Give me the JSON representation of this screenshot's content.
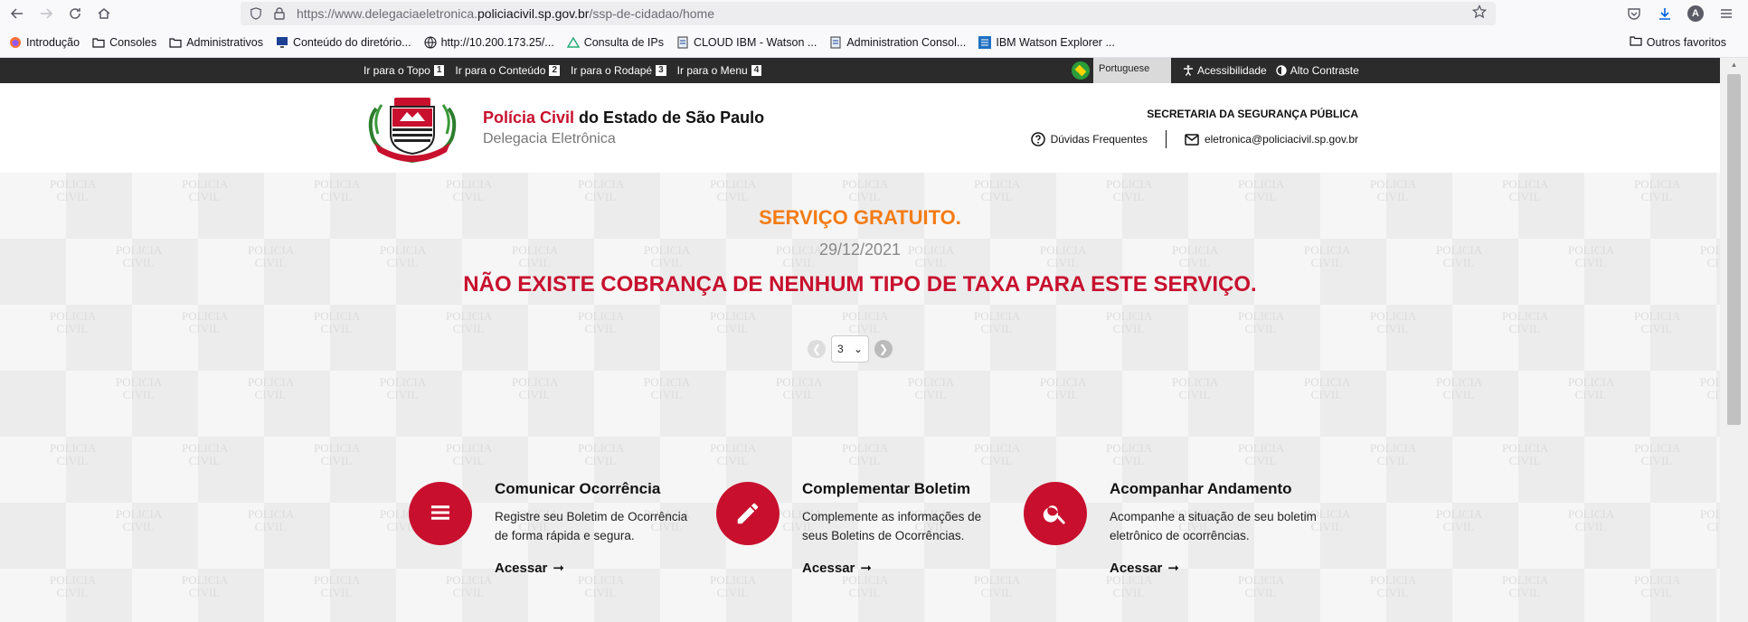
{
  "browser": {
    "url_prefix": "https://www.delegaciaeletronica.",
    "url_domain": "policiacivil.sp.gov.br",
    "url_path": "/ssp-de-cidadao/home",
    "avatar_letter": "A"
  },
  "bookmarks": {
    "items": [
      {
        "label": "Introdução",
        "icon": "firefox-icon"
      },
      {
        "label": "Consoles",
        "icon": "folder-icon"
      },
      {
        "label": "Administrativos",
        "icon": "folder-icon"
      },
      {
        "label": "Conteúdo do diretório...",
        "icon": "monitor-icon"
      },
      {
        "label": "http://10.200.173.25/...",
        "icon": "globe-icon"
      },
      {
        "label": "Consulta de IPs",
        "icon": "triangle-icon"
      },
      {
        "label": "CLOUD IBM - Watson ...",
        "icon": "page-icon"
      },
      {
        "label": "Administration Consol...",
        "icon": "page-icon"
      },
      {
        "label": "IBM Watson Explorer ...",
        "icon": "ibm-icon"
      }
    ],
    "others": "Outros favoritos"
  },
  "accbar": {
    "links": [
      {
        "label": "Ir para o Topo",
        "key": "1"
      },
      {
        "label": "Ir para o Conteúdo",
        "key": "2"
      },
      {
        "label": "Ir para o Rodapé",
        "key": "3"
      },
      {
        "label": "Ir para o Menu",
        "key": "4"
      }
    ],
    "language": "Portuguese",
    "accessibility": "Acessibilidade",
    "contrast": "Alto Contraste"
  },
  "header": {
    "title_red": "Polícia Civil",
    "title_rest": " do Estado de São Paulo",
    "subtitle": "Delegacia Eletrônica",
    "secretaria": "SECRETARIA DA SEGURANÇA PÚBLICA",
    "faq": "Dúvidas Frequentes",
    "email": "eletronica@policiacivil.sp.gov.br",
    "logo_text_top": "POLICIA CIVIL",
    "logo_text_bottom": "SÃO PAULO"
  },
  "hero": {
    "title": "SERVIÇO GRATUITO.",
    "date": "29/12/2021",
    "message": "NÃO EXISTE COBRANÇA DE NENHUM TIPO DE TAXA PARA ESTE SERVIÇO.",
    "page": "3",
    "watermark": "POLICIA CIVIL"
  },
  "services": [
    {
      "title": "Comunicar Ocorrência",
      "desc": "Registre seu Boletim de Ocorrência de forma rápida e segura.",
      "link": "Acessar",
      "icon": "list-icon"
    },
    {
      "title": "Complementar Boletim",
      "desc": "Complemente as informações de seus Boletins de Ocorrências.",
      "link": "Acessar",
      "icon": "pencil-icon"
    },
    {
      "title": "Acompanhar Andamento",
      "desc": "Acompanhe a situação de seu boletim eletrônico de ocorrências.",
      "link": "Acessar",
      "icon": "search-icon"
    }
  ],
  "colors": {
    "brand_red": "#c8102e",
    "accent_orange": "#f47c15",
    "accbar_bg": "#2b2b2b"
  }
}
